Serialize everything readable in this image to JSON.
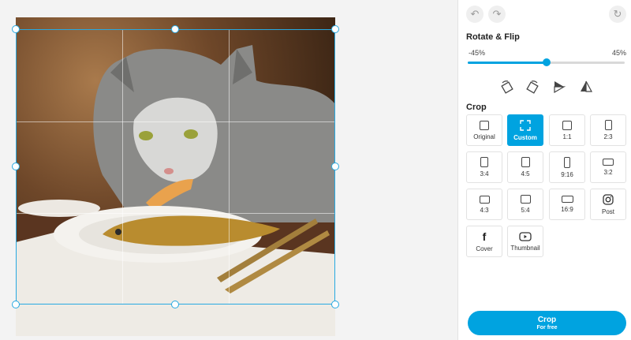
{
  "toolbar": {
    "undo_icon": "undo-icon",
    "redo_icon": "redo-icon",
    "reset_icon": "reset-icon"
  },
  "rotate_flip": {
    "title": "Rotate & Flip",
    "min_label": "-45%",
    "max_label": "45%",
    "value": 0.5,
    "tools": [
      "rotate-left-icon",
      "rotate-right-icon",
      "flip-vertical-icon",
      "flip-horizontal-icon"
    ]
  },
  "crop": {
    "title": "Crop",
    "options": [
      {
        "label": "Original",
        "selected": false
      },
      {
        "label": "Custom",
        "selected": true
      },
      {
        "label": "1:1",
        "selected": false
      },
      {
        "label": "2:3",
        "selected": false
      },
      {
        "label": "3:4",
        "selected": false
      },
      {
        "label": "4:5",
        "selected": false
      },
      {
        "label": "9:16",
        "selected": false
      },
      {
        "label": "3:2",
        "selected": false
      },
      {
        "label": "4:3",
        "selected": false
      },
      {
        "label": "5:4",
        "selected": false
      },
      {
        "label": "16:9",
        "selected": false
      },
      {
        "label": "Post",
        "selected": false
      },
      {
        "label": "Cover",
        "selected": false
      },
      {
        "label": "Thumbnail",
        "selected": false
      }
    ]
  },
  "crop_button": {
    "label": "Crop",
    "sublabel": "For free"
  },
  "colors": {
    "accent": "#00a3e0",
    "frame": "#27a9e1"
  }
}
